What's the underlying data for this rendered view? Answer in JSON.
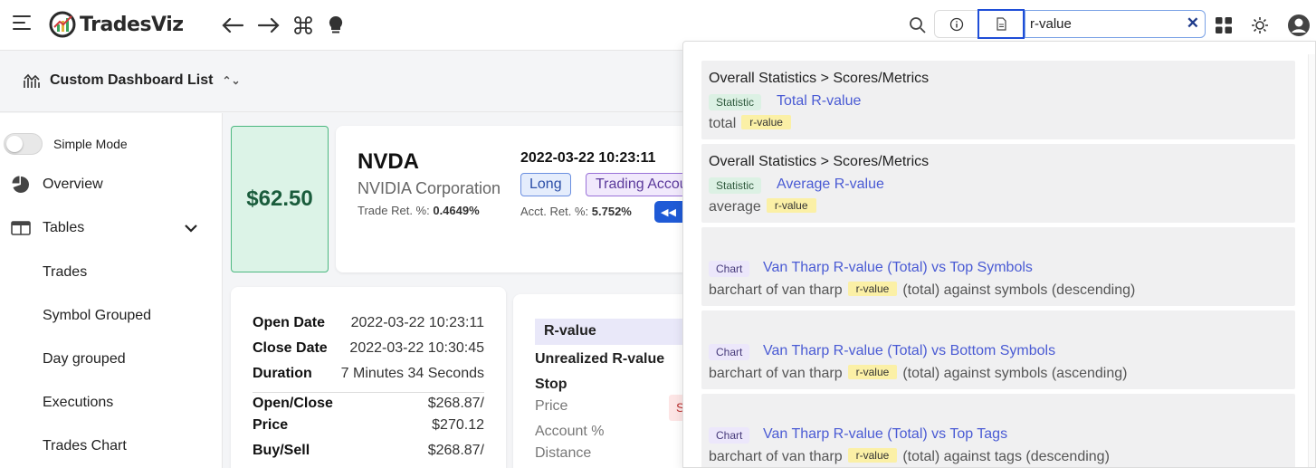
{
  "app": {
    "name": "TradesViz"
  },
  "search": {
    "value": "r-value"
  },
  "subheader": {
    "title": "Custom Dashboard List"
  },
  "sidebar": {
    "simple_mode_label": "Simple Mode",
    "items": [
      {
        "label": "Overview",
        "icon": "pie-chart-icon"
      },
      {
        "label": "Tables",
        "icon": "table-icon"
      }
    ],
    "sub_items": [
      "Trades",
      "Symbol Grouped",
      "Day grouped",
      "Executions",
      "Trades Chart"
    ]
  },
  "trade": {
    "price": "$62.50",
    "ticker": "NVDA",
    "company": "NVIDIA Corporation",
    "trade_ret_label": "Trade Ret. %:",
    "trade_ret_value": "0.4649%",
    "open_datetime": "2022-03-22 10:23:11",
    "side": "Long",
    "account": "Trading Account",
    "acct_ret_label": "Acct. Ret. %:",
    "acct_ret_value": "5.752%"
  },
  "details": {
    "open_date_label": "Open Date",
    "open_date": "2022-03-22 10:23:11",
    "close_date_label": "Close Date",
    "close_date": "2022-03-22 10:30:45",
    "duration_label": "Duration",
    "duration": "7 Minutes 34 Seconds",
    "open_close_label_1": "Open/Close",
    "open_close_label_2": "Price",
    "open_close_value_1": "$268.87/",
    "open_close_value_2": "$270.12",
    "buy_sell_label": "Buy/Sell",
    "buy_sell_value": "$268.87/"
  },
  "rvalue_card": {
    "header": "R-value",
    "unrealized": "Unrealized R-value",
    "stop": "Stop",
    "price": "Price",
    "account_pct": "Account %",
    "distance": "Distance",
    "red_chip": "S"
  },
  "results": [
    {
      "path": "Overall Statistics > Scores/Metrics",
      "badge": "Statistic",
      "title": "Total R-value",
      "desc_pre": "total",
      "highlight": "r-value",
      "desc_post": ""
    },
    {
      "path": "Overall Statistics > Scores/Metrics",
      "badge": "Statistic",
      "title": "Average R-value",
      "desc_pre": "average",
      "highlight": "r-value",
      "desc_post": ""
    },
    {
      "path": "",
      "badge": "Chart",
      "title": "Van Tharp R-value (Total) vs Top Symbols",
      "desc_pre": "barchart of van tharp",
      "highlight": "r-value",
      "desc_post": "(total) against symbols (descending)"
    },
    {
      "path": "",
      "badge": "Chart",
      "title": "Van Tharp R-value (Total) vs Bottom Symbols",
      "desc_pre": "barchart of van tharp",
      "highlight": "r-value",
      "desc_post": "(total) against symbols (ascending)"
    },
    {
      "path": "",
      "badge": "Chart",
      "title": "Van Tharp R-value (Total) vs Top Tags",
      "desc_pre": "barchart of van tharp",
      "highlight": "r-value",
      "desc_post": "(total) against tags (descending)"
    }
  ],
  "colors": {
    "accent": "#1f4ed8",
    "link": "#4a5bd4",
    "price_green": "#1a5c3c"
  }
}
